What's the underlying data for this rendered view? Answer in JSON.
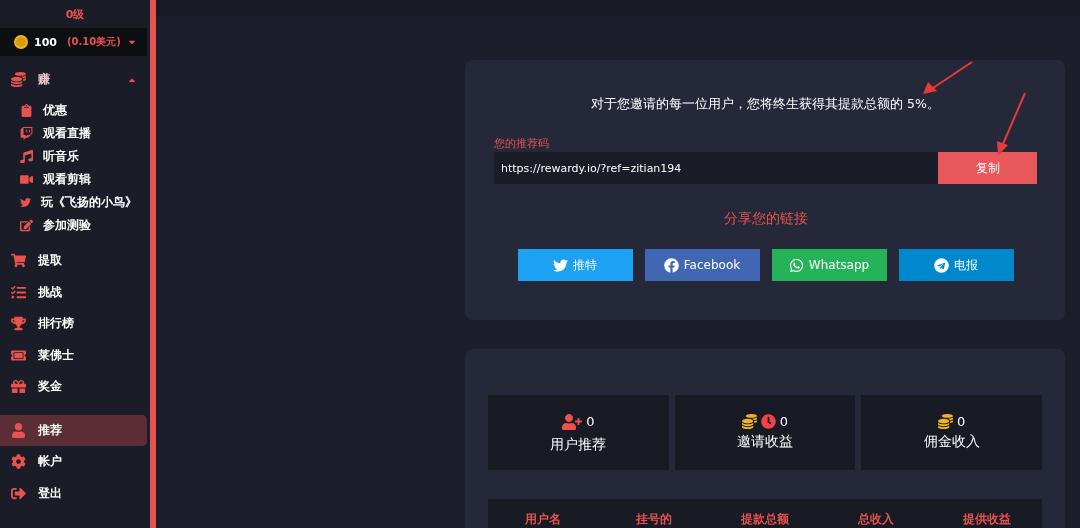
{
  "sidebar": {
    "level": "0级",
    "balance": {
      "coins": "100",
      "usd": "(0.10美元)"
    },
    "items": [
      {
        "label": "赚",
        "kind": "group",
        "expanded": true,
        "selected": false,
        "children": [
          {
            "label": "优惠",
            "selected": false
          },
          {
            "label": "观看直播",
            "selected": false
          },
          {
            "label": "听音乐",
            "selected": false
          },
          {
            "label": "观看剪辑",
            "selected": false
          },
          {
            "label": "玩《飞扬的小鸟》",
            "selected": false
          },
          {
            "label": "参加测验",
            "selected": false
          }
        ]
      },
      {
        "label": "提取",
        "kind": "item",
        "selected": false
      },
      {
        "label": "挑战",
        "kind": "item",
        "selected": false
      },
      {
        "label": "排行榜",
        "kind": "item",
        "selected": false
      },
      {
        "label": "莱佛士",
        "kind": "item",
        "selected": false
      },
      {
        "label": "奖金",
        "kind": "item",
        "selected": false
      },
      {
        "label": "推荐",
        "kind": "item",
        "selected": true
      },
      {
        "label": "帐户",
        "kind": "item",
        "selected": false
      },
      {
        "label": "登出",
        "kind": "item",
        "selected": false
      }
    ]
  },
  "referral": {
    "description": "对于您邀请的每一位用户，您将终生获得其提款总额的 5%。",
    "code_label": "您的推荐码",
    "code_value": "https://rewardy.io/?ref=zitian194",
    "copy_button": "复制",
    "share_title": "分享您的链接",
    "share_buttons": [
      {
        "label": "推特",
        "color": "#1da1f2"
      },
      {
        "label": "Facebook",
        "color": "#4267b2"
      },
      {
        "label": "Whatsapp",
        "color": "#25b35a"
      },
      {
        "label": "电报",
        "color": "#0088cc"
      }
    ]
  },
  "stats": [
    {
      "value": "0",
      "label": "用户推荐"
    },
    {
      "value": "0",
      "label": "邀请收益"
    },
    {
      "value": "0",
      "label": "佣金收入"
    }
  ],
  "table": {
    "columns": [
      "用户名",
      "挂号的",
      "提款总额",
      "总收入",
      "提供收益"
    ]
  }
}
